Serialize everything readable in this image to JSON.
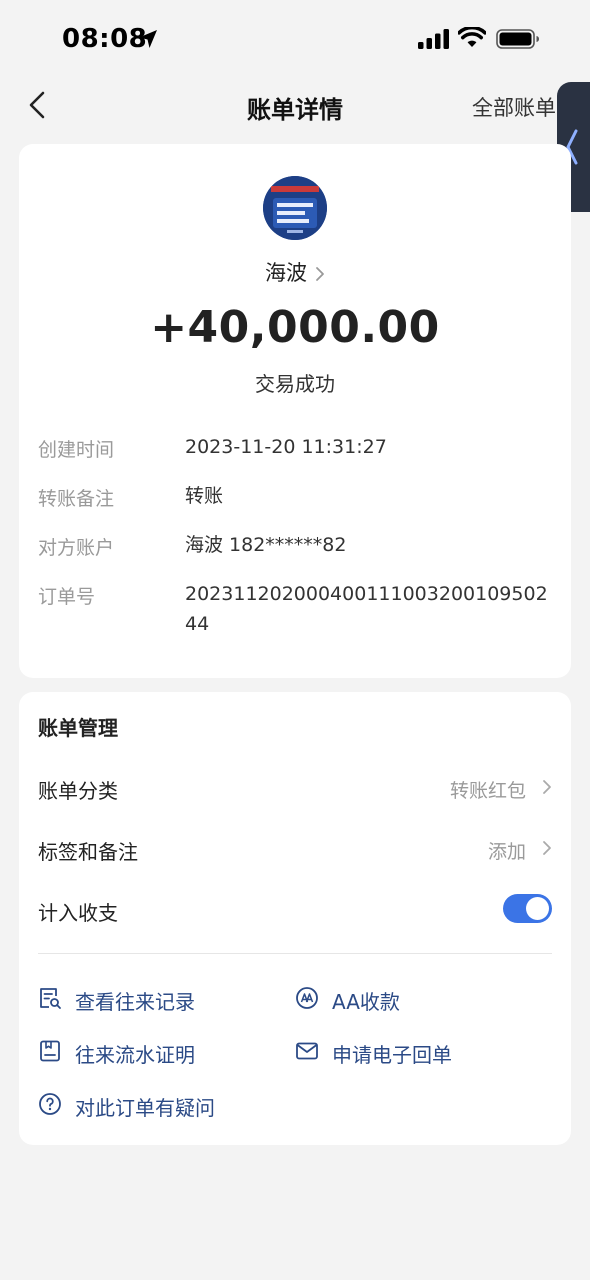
{
  "status_bar": {
    "time": "08:08"
  },
  "nav": {
    "title": "账单详情",
    "right_label": "全部账单"
  },
  "transaction": {
    "payee": "海波",
    "amount": "+40,000.00",
    "status": "交易成功",
    "details": [
      {
        "label": "创建时间",
        "value": "2023-11-20 11:31:27"
      },
      {
        "label": "转账备注",
        "value": "转账"
      },
      {
        "label": "对方账户",
        "value": "海波 182******82"
      },
      {
        "label": "订单号",
        "value": "20231120200040011100320010950244"
      }
    ]
  },
  "management": {
    "title": "账单管理",
    "category_label": "账单分类",
    "category_value": "转账红包",
    "tags_label": "标签和备注",
    "tags_value": "添加",
    "include_label": "计入收支",
    "include_enabled": true
  },
  "actions": {
    "history": "查看往来记录",
    "aa": "AA收款",
    "statement": "往来流水证明",
    "receipt": "申请电子回单",
    "question": "对此订单有疑问"
  },
  "colors": {
    "accent": "#3b74e6",
    "link": "#2b4a86",
    "avatar_bg": "#1d3f86"
  }
}
